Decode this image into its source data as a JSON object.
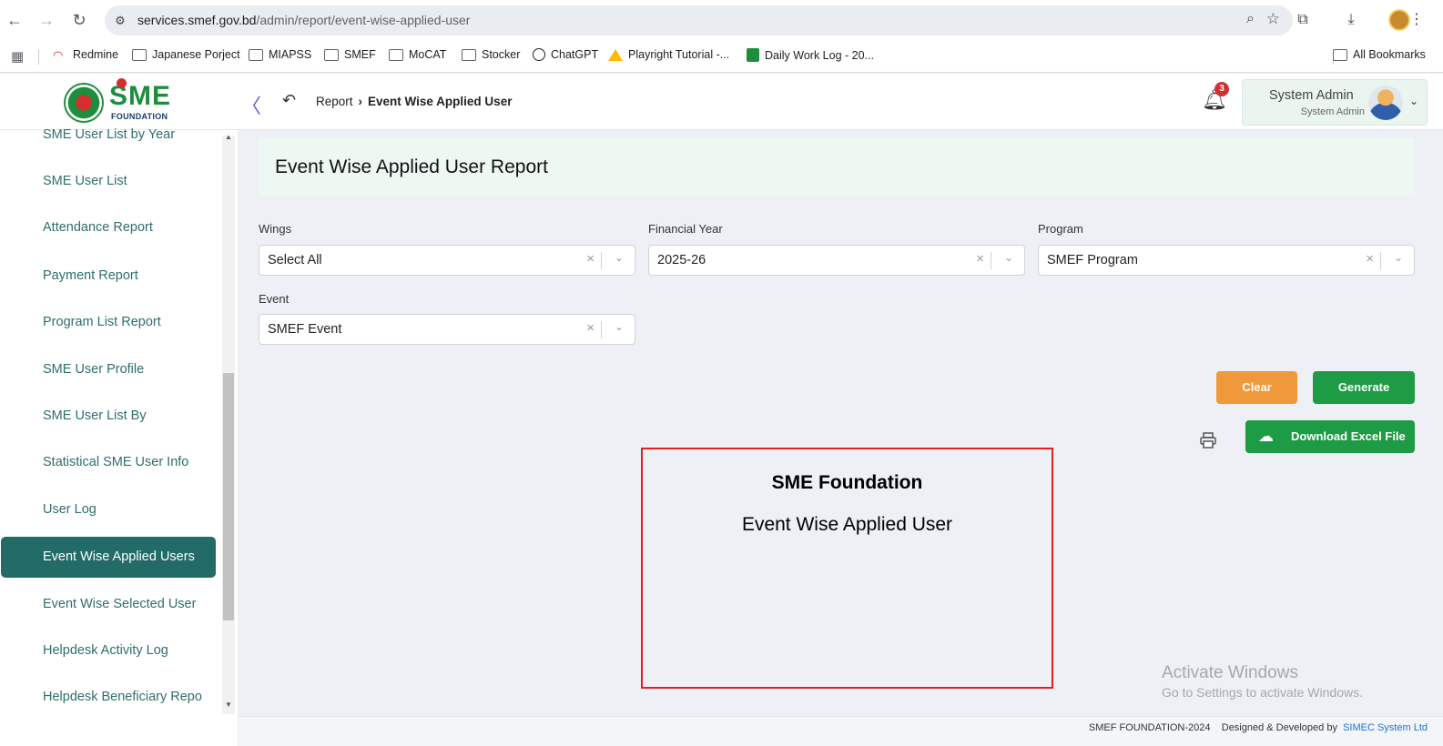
{
  "browser": {
    "url_host": "services.smef.gov.bd",
    "url_path": "/admin/report/event-wise-applied-user"
  },
  "bookmarks": [
    {
      "label": "Redmine",
      "icon": "redmine-icon"
    },
    {
      "label": "Japanese Porject",
      "icon": "folder-icon"
    },
    {
      "label": "MIAPSS",
      "icon": "folder-icon"
    },
    {
      "label": "SMEF",
      "icon": "folder-icon"
    },
    {
      "label": "MoCAT",
      "icon": "folder-icon"
    },
    {
      "label": "Stocker",
      "icon": "folder-icon"
    },
    {
      "label": "ChatGPT",
      "icon": "chatgpt-icon"
    },
    {
      "label": "Playright Tutorial -...",
      "icon": "drive-icon"
    },
    {
      "label": "Daily Work Log - 20...",
      "icon": "sheets-icon"
    }
  ],
  "all_bookmarks": "All Bookmarks",
  "header": {
    "logo_text": "SME",
    "logo_sub": "FOUNDATION",
    "breadcrumb": {
      "parent": "Report",
      "current": "Event Wise Applied User"
    },
    "notifications": "3",
    "user": {
      "name": "System Admin",
      "role": "System Admin"
    }
  },
  "sidebar": {
    "items": [
      "SME User List by Year",
      "SME User List",
      "Attendance Report",
      "Payment Report",
      "Program List Report",
      "SME User Profile",
      "SME User List By",
      "Statistical SME User Info",
      "User Log",
      "Event Wise Applied Users",
      "Event Wise Selected User",
      "Helpdesk Activity Log",
      "Helpdesk Beneficiary Report"
    ],
    "active_index": 9
  },
  "page": {
    "title": "Event Wise Applied User Report",
    "filters": {
      "wings": {
        "label": "Wings",
        "value": "Select All"
      },
      "financial_year": {
        "label": "Financial Year",
        "value": "2025-26"
      },
      "program": {
        "label": "Program",
        "value": "SMEF Program"
      },
      "event": {
        "label": "Event",
        "value": "SMEF Event"
      }
    },
    "buttons": {
      "clear": "Clear",
      "generate": "Generate",
      "download": "Download Excel File"
    },
    "report": {
      "org": "SME Foundation",
      "title": "Event Wise Applied User"
    }
  },
  "watermark": {
    "line1": "Activate Windows",
    "line2": "Go to Settings to activate Windows."
  },
  "footer": {
    "copyright": "SMEF FOUNDATION-2024",
    "designed": "Designed & Developed by",
    "company": "SIMEC System Ltd"
  },
  "colors": {
    "accent": "#236b67",
    "success": "#1e9b45",
    "warning": "#f0993b",
    "highlight_border": "#e02020"
  }
}
